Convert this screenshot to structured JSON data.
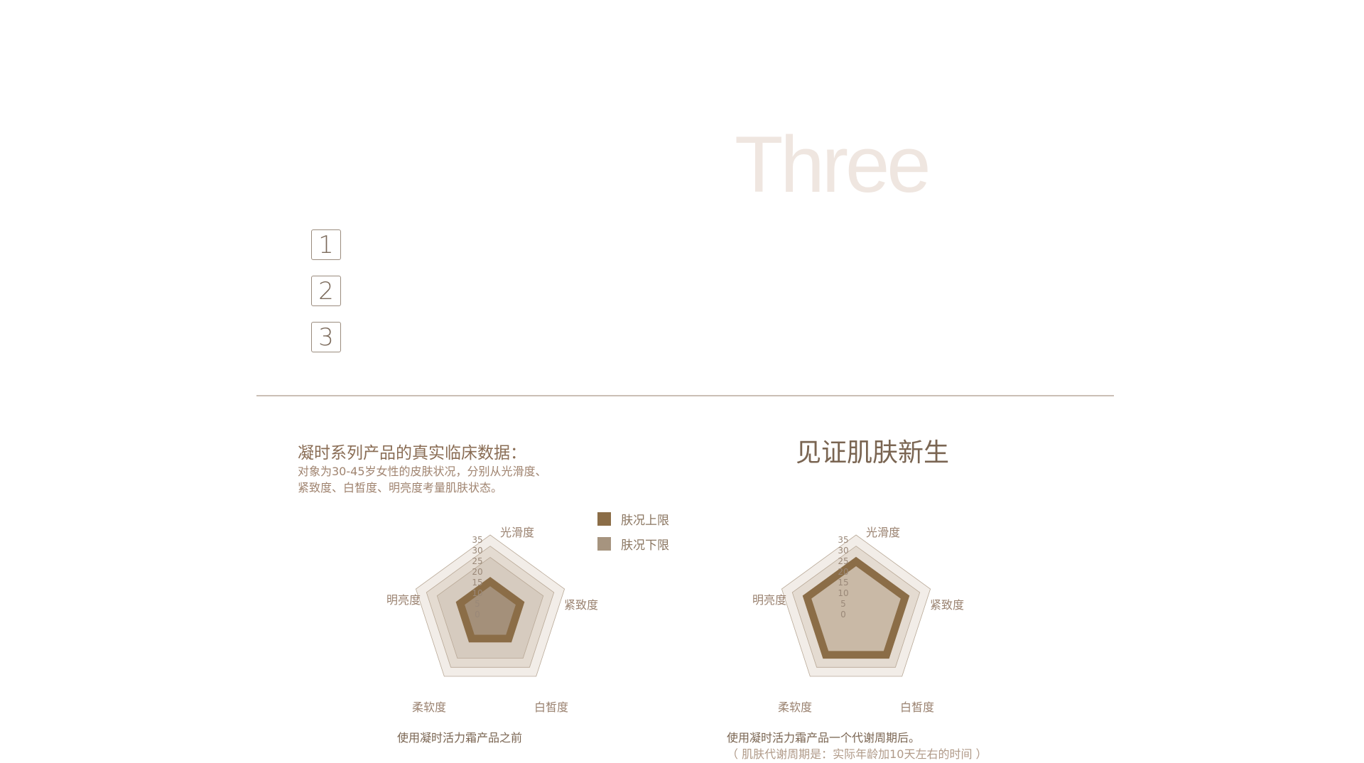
{
  "watermark": "Three",
  "numbered_boxes": [
    "1",
    "2",
    "3"
  ],
  "intro": {
    "title": "凝时系列产品的真实临床数据：",
    "desc_line1": "对象为30-45岁女性的皮肤状况，分别从光滑度、",
    "desc_line2": "紧致度、白皙度、明亮度考量肌肤状态。"
  },
  "headline": "见证肌肤新生",
  "legend": [
    {
      "label": "肤况上限",
      "color": "#8b6d47"
    },
    {
      "label": "肤况下限",
      "color": "#a6947f"
    }
  ],
  "captions": {
    "before": "使用凝时活力霜产品之前",
    "after": "使用凝时活力霜产品一个代谢周期后。",
    "after_note": "（ 肌肤代谢周期是：实际年龄加10天左右的时间 ）"
  },
  "colors": {
    "upper": "#8b6d47",
    "lower": "#a6947f",
    "ring_outer": "#f2ede8",
    "ring_mid": "#e4dbd1",
    "ring_inner": "#d6cbbf",
    "ring_stroke": "#b8a896"
  },
  "chart_data": [
    {
      "type": "radar",
      "axes": [
        "光滑度",
        "紧致度",
        "白皙度",
        "柔软度",
        "明亮度"
      ],
      "ticks": [
        "35",
        "30",
        "25",
        "20",
        "15",
        "10",
        "5",
        "0"
      ],
      "range": [
        0,
        35
      ],
      "series": [
        {
          "name": "肤况上限",
          "values": [
            16,
            16,
            16,
            16,
            16
          ]
        },
        {
          "name": "肤况下限",
          "values": [
            12,
            12,
            12,
            12,
            12
          ]
        }
      ]
    },
    {
      "type": "radar",
      "axes": [
        "光滑度",
        "紧致度",
        "白皙度",
        "柔软度",
        "明亮度"
      ],
      "ticks": [
        "35",
        "30",
        "25",
        "20",
        "15",
        "10",
        "5",
        "0"
      ],
      "range": [
        0,
        35
      ],
      "series": [
        {
          "name": "肤况上限",
          "values": [
            25,
            25,
            25,
            25,
            25
          ]
        },
        {
          "name": "肤况下限",
          "values": [
            21,
            21,
            21,
            21,
            21
          ]
        }
      ]
    }
  ]
}
